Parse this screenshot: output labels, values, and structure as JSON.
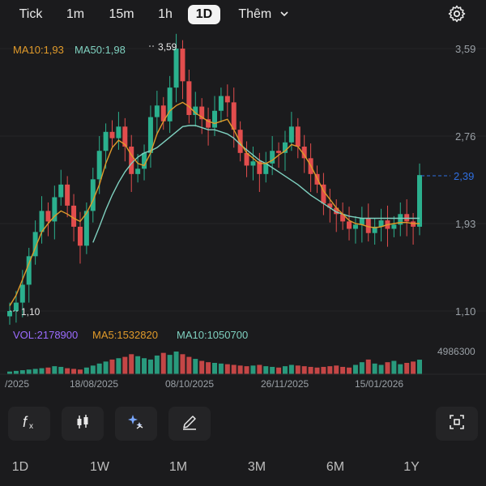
{
  "timeframe_tabs": [
    {
      "label": "Tick",
      "active": false
    },
    {
      "label": "1m",
      "active": false
    },
    {
      "label": "15m",
      "active": false
    },
    {
      "label": "1h",
      "active": false
    },
    {
      "label": "1D",
      "active": true
    },
    {
      "label": "Thêm",
      "active": false
    }
  ],
  "icons": {
    "settings": "gear-icon",
    "more": "chevron-down-icon",
    "indicator": "function-icon",
    "chart_type": "candlestick-icon",
    "ai": "sparkle-icon",
    "draw": "pencil-icon",
    "fullscreen": "expand-icon"
  },
  "colors": {
    "up": "#2bb08e",
    "down": "#e24d4d",
    "ma10": "#e09a2a",
    "ma50": "#7fd1c0",
    "vol_label": "#9b6cff",
    "current_price": "#2f6fe0"
  },
  "main_legend": {
    "ma10": "MA10:1,93",
    "ma50": "MA50:1,98"
  },
  "volume_legend": {
    "vol": "VOL:2178900",
    "ma5": "MA5:1532820",
    "ma10": "MA10:1050700"
  },
  "volume_max_label": "4986300",
  "current_price_label": "2,39",
  "high_marker": "3,59",
  "low_marker": "1,10",
  "range_buttons": [
    "1D",
    "1W",
    "1M",
    "3M",
    "6M",
    "1Y"
  ],
  "chart_data": {
    "type": "candlestick",
    "price_axis_ticks": [
      "3,59",
      "2,76",
      "1,93",
      "1,10"
    ],
    "ylim": [
      1.1,
      3.59
    ],
    "date_labels": [
      "/2025",
      "18/08/2025",
      "08/10/2025",
      "26/11/2025",
      "15/01/2026"
    ],
    "close_series": [
      1.1,
      1.18,
      1.35,
      1.62,
      1.85,
      2.05,
      1.95,
      2.18,
      2.3,
      2.1,
      1.9,
      1.72,
      2.05,
      2.35,
      2.62,
      2.8,
      2.74,
      2.85,
      2.66,
      2.4,
      2.45,
      2.6,
      2.94,
      3.05,
      2.9,
      3.22,
      3.59,
      3.28,
      2.96,
      3.04,
      2.92,
      2.84,
      3.0,
      3.14,
      3.08,
      2.82,
      2.6,
      2.48,
      2.52,
      2.4,
      2.5,
      2.62,
      2.6,
      2.7,
      2.85,
      2.66,
      2.55,
      2.4,
      2.3,
      2.12,
      2.08,
      2.02,
      1.95,
      1.88,
      1.92,
      1.98,
      1.84,
      1.9,
      1.96,
      1.88,
      1.92,
      2.02,
      1.95,
      1.9,
      2.39
    ],
    "ma10": [
      1.15,
      1.25,
      1.4,
      1.55,
      1.7,
      1.85,
      1.93,
      2.0,
      2.05,
      2.02,
      1.98,
      1.95,
      2.03,
      2.15,
      2.3,
      2.5,
      2.65,
      2.72,
      2.68,
      2.58,
      2.5,
      2.48,
      2.6,
      2.78,
      2.9,
      3.0,
      3.05,
      3.08,
      3.04,
      2.98,
      2.94,
      2.9,
      2.88,
      2.9,
      2.92,
      2.82,
      2.7,
      2.6,
      2.55,
      2.5,
      2.5,
      2.53,
      2.58,
      2.62,
      2.68,
      2.66,
      2.58,
      2.48,
      2.36,
      2.24,
      2.16,
      2.08,
      2.02,
      1.96,
      1.93,
      1.92,
      1.9,
      1.89,
      1.9,
      1.92,
      1.93,
      1.94,
      1.94,
      1.93,
      1.93
    ],
    "ma50": [
      null,
      null,
      null,
      null,
      null,
      null,
      null,
      null,
      null,
      null,
      null,
      null,
      null,
      1.75,
      1.9,
      2.06,
      2.2,
      2.32,
      2.42,
      2.5,
      2.56,
      2.6,
      2.62,
      2.65,
      2.7,
      2.75,
      2.8,
      2.85,
      2.86,
      2.86,
      2.84,
      2.82,
      2.82,
      2.8,
      2.78,
      2.74,
      2.68,
      2.63,
      2.58,
      2.53,
      2.5,
      2.46,
      2.42,
      2.38,
      2.34,
      2.3,
      2.25,
      2.2,
      2.16,
      2.12,
      2.08,
      2.04,
      2.02,
      2.0,
      1.99,
      1.98,
      1.98,
      1.98,
      1.98,
      1.98,
      1.98,
      1.98,
      1.98,
      1.98,
      1.98
    ],
    "volume": [
      0.4,
      0.5,
      0.6,
      0.7,
      0.8,
      0.9,
      1.0,
      1.2,
      1.1,
      0.9,
      0.8,
      0.7,
      1.0,
      1.3,
      1.6,
      1.9,
      2.2,
      2.4,
      2.6,
      3.0,
      2.7,
      2.4,
      2.2,
      2.8,
      3.2,
      2.9,
      3.4,
      3.0,
      2.6,
      2.3,
      2.0,
      1.8,
      1.7,
      1.6,
      1.5,
      1.4,
      1.3,
      1.2,
      1.3,
      1.4,
      1.2,
      1.1,
      1.0,
      1.2,
      1.4,
      1.3,
      1.2,
      1.1,
      1.0,
      1.1,
      1.2,
      1.3,
      1.1,
      1.0,
      1.4,
      1.8,
      2.2,
      1.6,
      1.4,
      1.8,
      2.0,
      1.5,
      1.7,
      1.9,
      2.18
    ]
  }
}
